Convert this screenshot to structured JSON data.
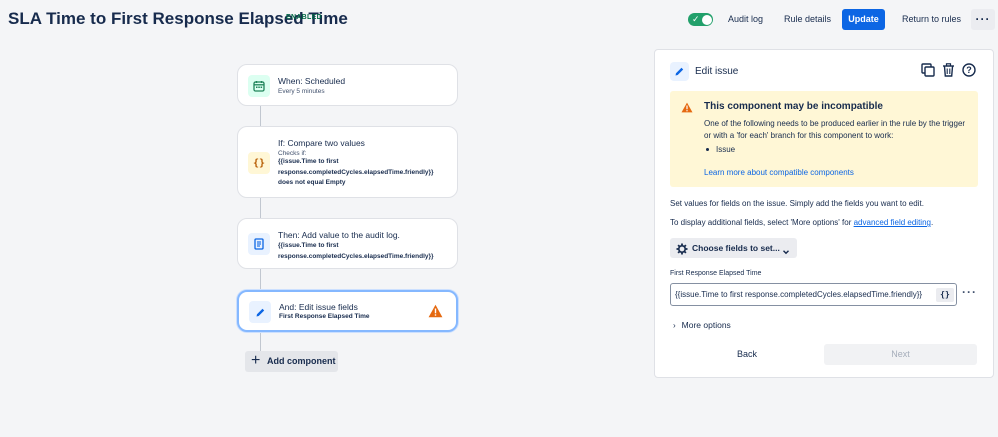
{
  "header": {
    "title": "SLA Time to First Response Elapsed Time",
    "status_badge": "ENABLED",
    "toggle_on": true,
    "audit_log_label": "Audit log",
    "rule_details_label": "Rule details",
    "update_label": "Update",
    "return_label": "Return to rules",
    "more_icon": "ellipsis-icon",
    "accent_color": "#0c66e4",
    "toggle_color": "#22a06b"
  },
  "flow": {
    "nodes": [
      {
        "icon": "calendar-icon",
        "title": "When: Scheduled",
        "subtitle": "Every 5 minutes"
      },
      {
        "icon": "braces-icon",
        "title": "If: Compare two values",
        "subtitle": "Checks if:",
        "code_lines": [
          "{{issue.Time to first",
          "response.completedCycles.elapsedTime.friendly}}",
          "does not equal Empty"
        ]
      },
      {
        "icon": "document-icon",
        "title": "Then: Add value to the audit log.",
        "code_lines": [
          "{{issue.Time to first",
          "response.completedCycles.elapsedTime.friendly}}"
        ]
      },
      {
        "icon": "pencil-icon",
        "title": "And: Edit issue fields",
        "code_lines": [
          "First Response Elapsed Time"
        ],
        "selected": true,
        "warning_icon": "warning-icon"
      }
    ],
    "add_component_label": "Add component"
  },
  "panel": {
    "title": "Edit issue",
    "tool_icons": [
      "copy-icon",
      "trash-icon",
      "help-icon"
    ],
    "warning": {
      "title": "This component may be incompatible",
      "body": "One of the following needs to be produced earlier in the rule by the trigger or with a 'for each' branch for this component to work:",
      "items": [
        "Issue"
      ],
      "link": "Learn more about compatible components",
      "color": "#fff7d6"
    },
    "description": "Set values for fields on the issue. Simply add the fields you want to edit.",
    "additional_prefix": "To display additional fields, select 'More options' for ",
    "additional_link": "advanced field editing",
    "additional_suffix": ".",
    "choose_fields_label": "Choose fields to set...",
    "field_label": "First Response Elapsed Time",
    "field_value": "{{issue.Time to first response.completedCycles.elapsedTime.friendly}}",
    "brace_button": "{}",
    "more_options_label": "More options",
    "back_label": "Back",
    "next_label": "Next"
  }
}
